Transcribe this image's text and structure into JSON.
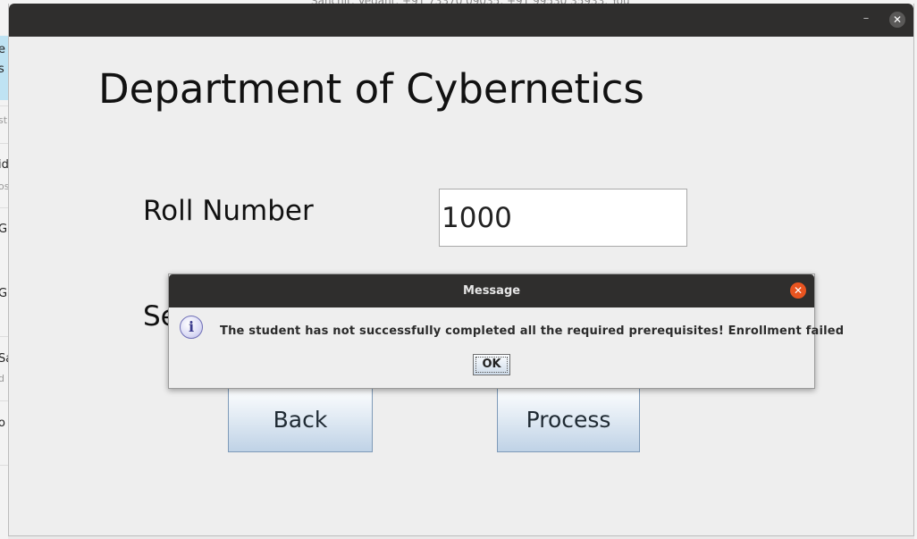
{
  "background_app": {
    "top_text": "Sanchit, Vedant, +91 73370 09035, +91 99530 35933, You",
    "left_rows": [
      "e",
      "s",
      "st",
      "id",
      "os",
      "G",
      "G",
      "Sa",
      "d",
      "o"
    ]
  },
  "window": {
    "minimize_glyph": "–",
    "close_glyph": "✕",
    "title": "Department of Cybernetics",
    "roll_label": "Roll Number",
    "roll_value": "1000",
    "semester_label_partial": "Se",
    "back_label": "Back",
    "process_label": "Process"
  },
  "dialog": {
    "title": "Message",
    "close_glyph": "✕",
    "icon": "info-icon",
    "icon_glyph": "i",
    "message": "The student has not successfully completed all the required prerequisites! Enrollment failed",
    "ok_label": "OK"
  },
  "colors": {
    "titlebar": "#2f2e2d",
    "dialog_close": "#e95420",
    "button_border": "#7e9ab8"
  }
}
